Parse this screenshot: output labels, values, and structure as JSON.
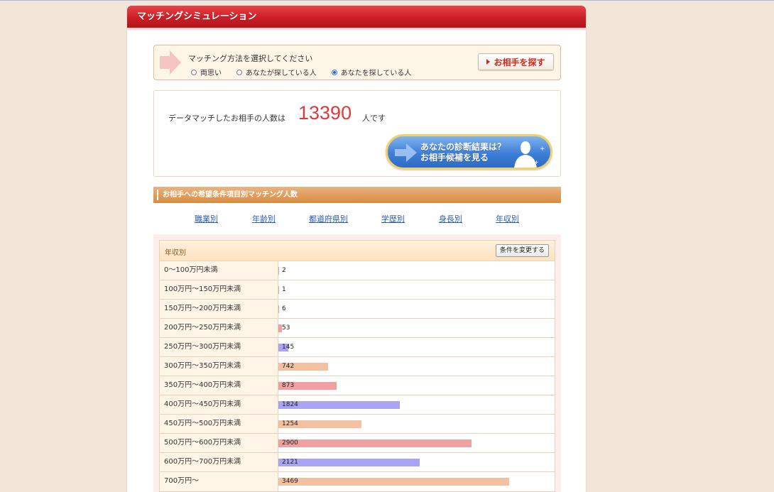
{
  "header": {
    "title": "マッチングシミュレーション"
  },
  "method": {
    "title": "マッチング方法を選択してください",
    "options": [
      {
        "label": "両思い",
        "checked": false
      },
      {
        "label": "あなたが探している人",
        "checked": false
      },
      {
        "label": "あなたを探している人",
        "checked": true
      }
    ],
    "search_button": "お相手を探す"
  },
  "result": {
    "label": "データマッチしたお相手の人数は",
    "count": "13390",
    "suffix": "人です",
    "diagnosis_line1": "あなたの診断結果は？",
    "diagnosis_line2": "お相手候補を見る"
  },
  "section": {
    "title": "お相手への希望条件項目別マッチング人数"
  },
  "categories": [
    "職業別",
    "年齢別",
    "都道府県別",
    "学歴別",
    "身長別",
    "年収別"
  ],
  "table": {
    "heading": "年収別",
    "change_button": "条件を変更する",
    "max": 3800,
    "rows": [
      {
        "label": "0〜100万円未満",
        "value": 2,
        "display": "2",
        "color": "#c0b8b0"
      },
      {
        "label": "100万円〜150万円未満",
        "value": 1,
        "display": "1",
        "color": "#c0b8b0"
      },
      {
        "label": "150万円〜200万円未満",
        "value": 6,
        "display": "6",
        "color": "#c0b8b0"
      },
      {
        "label": "200万円〜250万円未満",
        "value": 53,
        "display": "53",
        "color": "#f0a0a0"
      },
      {
        "label": "250万円〜300万円未満",
        "value": 145,
        "display": "145",
        "color": "#a8a4f2"
      },
      {
        "label": "300万円〜350万円未満",
        "value": 742,
        "display": "742",
        "color": "#f3c0a0"
      },
      {
        "label": "350万円〜400万円未満",
        "value": 873,
        "display": "873",
        "color": "#f0a0a0"
      },
      {
        "label": "400万円〜450万円未満",
        "value": 1824,
        "display": "1824",
        "color": "#a8a4f2"
      },
      {
        "label": "450万円〜500万円未満",
        "value": 1254,
        "display": "1254",
        "color": "#f3c0a0"
      },
      {
        "label": "500万円〜600万円未満",
        "value": 2900,
        "display": "2900",
        "color": "#f0a0a0"
      },
      {
        "label": "600万円〜700万円未満",
        "value": 2121,
        "display": "2121",
        "color": "#a8a4f2"
      },
      {
        "label": "700万円〜",
        "value": 3469,
        "display": "3469",
        "color": "#f3c0a0"
      }
    ]
  }
}
